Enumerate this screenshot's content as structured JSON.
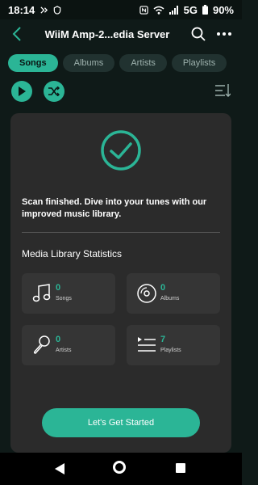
{
  "status": {
    "time": "18:14",
    "network": "5G",
    "battery": "90%",
    "left_icons": [
      "signal-bell-icon",
      "wechat-icon",
      "shield-icon"
    ],
    "right_icons": [
      "nfc-icon",
      "wifi-icon",
      "cell-signal-icon",
      "battery-icon"
    ]
  },
  "header": {
    "title": "WiiM Amp-2...edia Server",
    "icons": [
      "back-arrow-icon",
      "search-icon",
      "more-icon"
    ]
  },
  "tabs": [
    "Songs",
    "Albums",
    "Artists",
    "Playlists"
  ],
  "active_tab": "Songs",
  "controls": [
    "play-icon",
    "shuffle-icon",
    "sort-icon"
  ],
  "dialog": {
    "message": "Scan finished. Dive into your tunes with our improved music library.",
    "stats_title": "Media Library Statistics",
    "stats": [
      {
        "count": "0",
        "label": "Songs",
        "icon": "music-note-icon"
      },
      {
        "count": "0",
        "label": "Albums",
        "icon": "disc-icon"
      },
      {
        "count": "0",
        "label": "Artists",
        "icon": "microphone-icon"
      },
      {
        "count": "7",
        "label": "Playlists",
        "icon": "playlist-icon"
      }
    ],
    "button_label": "Let's Get Started"
  },
  "colors": {
    "accent": "#2bb596",
    "background": "#0f1a18",
    "card": "#2b2b2b",
    "stat_tile": "#353535"
  }
}
